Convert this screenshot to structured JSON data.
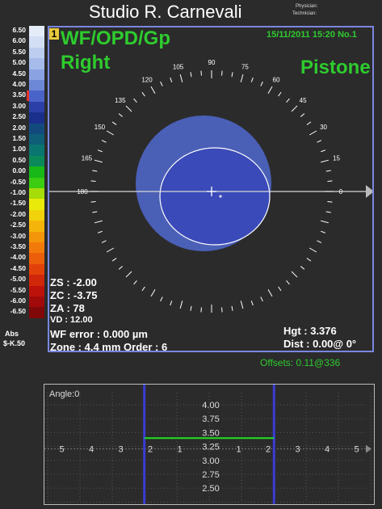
{
  "header": {
    "title": "Studio R.  Carnevali",
    "physician_label": "Physician:",
    "technician_label": "Technician:"
  },
  "scale": {
    "items": [
      {
        "label": "6.50",
        "color": "#e4ecf8"
      },
      {
        "label": "6.00",
        "color": "#d2def4"
      },
      {
        "label": "5.50",
        "color": "#bccdef"
      },
      {
        "label": "5.00",
        "color": "#a6bbea"
      },
      {
        "label": "4.50",
        "color": "#8aa2e2"
      },
      {
        "label": "4.00",
        "color": "#6e88d8"
      },
      {
        "label": "3.50",
        "color": "#4a63c8"
      },
      {
        "label": "3.00",
        "color": "#2c3fa8"
      },
      {
        "label": "2.50",
        "color": "#1a2f8c"
      },
      {
        "label": "2.00",
        "color": "#124a7e"
      },
      {
        "label": "1.50",
        "color": "#0e5e78"
      },
      {
        "label": "1.00",
        "color": "#0a7670"
      },
      {
        "label": "0.50",
        "color": "#0a8a5a"
      },
      {
        "label": "0.00",
        "color": "#18b818"
      },
      {
        "label": "-0.50",
        "color": "#3ccc12"
      },
      {
        "label": "-1.00",
        "color": "#a6dc0a"
      },
      {
        "label": "-1.50",
        "color": "#eaea0a"
      },
      {
        "label": "-2.00",
        "color": "#f2d20a"
      },
      {
        "label": "-2.50",
        "color": "#f4b40a"
      },
      {
        "label": "-3.00",
        "color": "#f4960a"
      },
      {
        "label": "-3.50",
        "color": "#f27a0a"
      },
      {
        "label": "-4.00",
        "color": "#ec5e0a"
      },
      {
        "label": "-4.50",
        "color": "#e2420a"
      },
      {
        "label": "-5.00",
        "color": "#d0260a"
      },
      {
        "label": "-5.50",
        "color": "#bc120a"
      },
      {
        "label": "-6.00",
        "color": "#a00a0a"
      },
      {
        "label": "-6.50",
        "color": "#800808"
      }
    ],
    "mode": "Abs",
    "step": "$-K.50",
    "marker_index": 6
  },
  "map": {
    "index": "1",
    "type_label": "WF/OPD/Gp",
    "eye": "Right",
    "term": "Pistone",
    "date": "15/11/2011 15:20 No.1",
    "angles": [
      "0",
      "15",
      "30",
      "45",
      "60",
      "75",
      "90",
      "105",
      "120",
      "135",
      "150",
      "165",
      "180"
    ],
    "zs": "ZS :  -2.00",
    "zc": "ZC :  -3.75",
    "za": "ZA :  78",
    "vd": "VD : 12.00",
    "wf_error": "WF error :  0.000 µm",
    "zone": "Zone : 4.4 mm Order  :  6",
    "hgt": "Hgt : 3.376",
    "dist": "Dist : 0.00@ 0°",
    "offsets": "Offsets: 0.11@336",
    "colors": {
      "fill": "#3a4ab8",
      "halo": "#4a5fb6",
      "frame": "#7a86e0",
      "accent": "#2ecb2e"
    }
  },
  "profile": {
    "angle_label": "Angle:0",
    "y_ticks": [
      "4.00",
      "3.75",
      "3.50",
      "3.25",
      "3.00",
      "2.75",
      "2.50"
    ],
    "x_ticks_left": [
      "5",
      "4",
      "3",
      "2",
      "1"
    ],
    "x_ticks_right": [
      "1",
      "2",
      "3",
      "4",
      "5"
    ],
    "level": 3.4,
    "zone_edges": [
      -2.2,
      2.2
    ]
  }
}
